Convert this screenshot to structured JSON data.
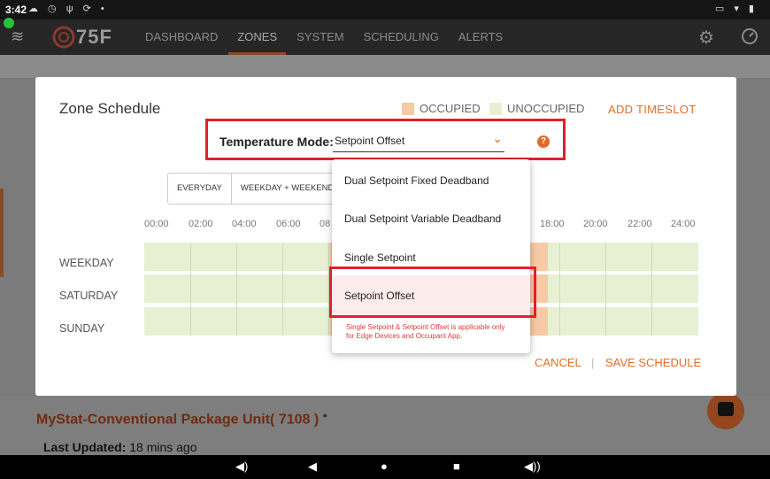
{
  "status_bar": {
    "time": "3:42"
  },
  "app": {
    "logo_text": "75F",
    "nav": [
      "DASHBOARD",
      "ZONES",
      "SYSTEM",
      "SCHEDULING",
      "ALERTS"
    ],
    "active_nav": "ZONES",
    "icons": [
      "layers-icon",
      "gear-icon",
      "gauge-icon"
    ]
  },
  "background": {
    "zone_title": "MyStat-Conventional Package Unit( 7108 )",
    "zone_title_mark": "●",
    "last_updated_label": "Last Updated:",
    "last_updated_value": "18 mins ago"
  },
  "dialog": {
    "title": "Zone Schedule",
    "legend_occupied": "OCCUPIED",
    "legend_unoccupied": "UNOCCUPIED",
    "add_timeslot": "ADD TIMESLOT",
    "temperature_mode_label": "Temperature Mode:",
    "temperature_mode_value": "Setpoint Offset",
    "help": "?",
    "tabs": [
      "EVERYDAY",
      "WEEKDAY + WEEKEND"
    ],
    "time_labels": [
      "00:00",
      "02:00",
      "04:00",
      "06:00",
      "08",
      "18:00",
      "20:00",
      "22:00",
      "24:00"
    ],
    "days": [
      "WEEKDAY",
      "SATURDAY",
      "SUNDAY"
    ],
    "cancel": "CANCEL",
    "separator": "|",
    "save": "SAVE SCHEDULE"
  },
  "dropdown": {
    "options": [
      "Dual Setpoint Fixed Deadband",
      "Dual Setpoint Variable Deadband",
      "Single Setpoint",
      "Setpoint Offset"
    ],
    "selected": "Setpoint Offset",
    "note": "Single Setpoint & Setpoint Offset is applicable only for Edge Devices and Occupant App."
  },
  "colors": {
    "accent": "#e36b2a",
    "occupied": "#f7c9a4",
    "unoccupied": "#e8f0d4",
    "highlight": "#e0202a"
  }
}
